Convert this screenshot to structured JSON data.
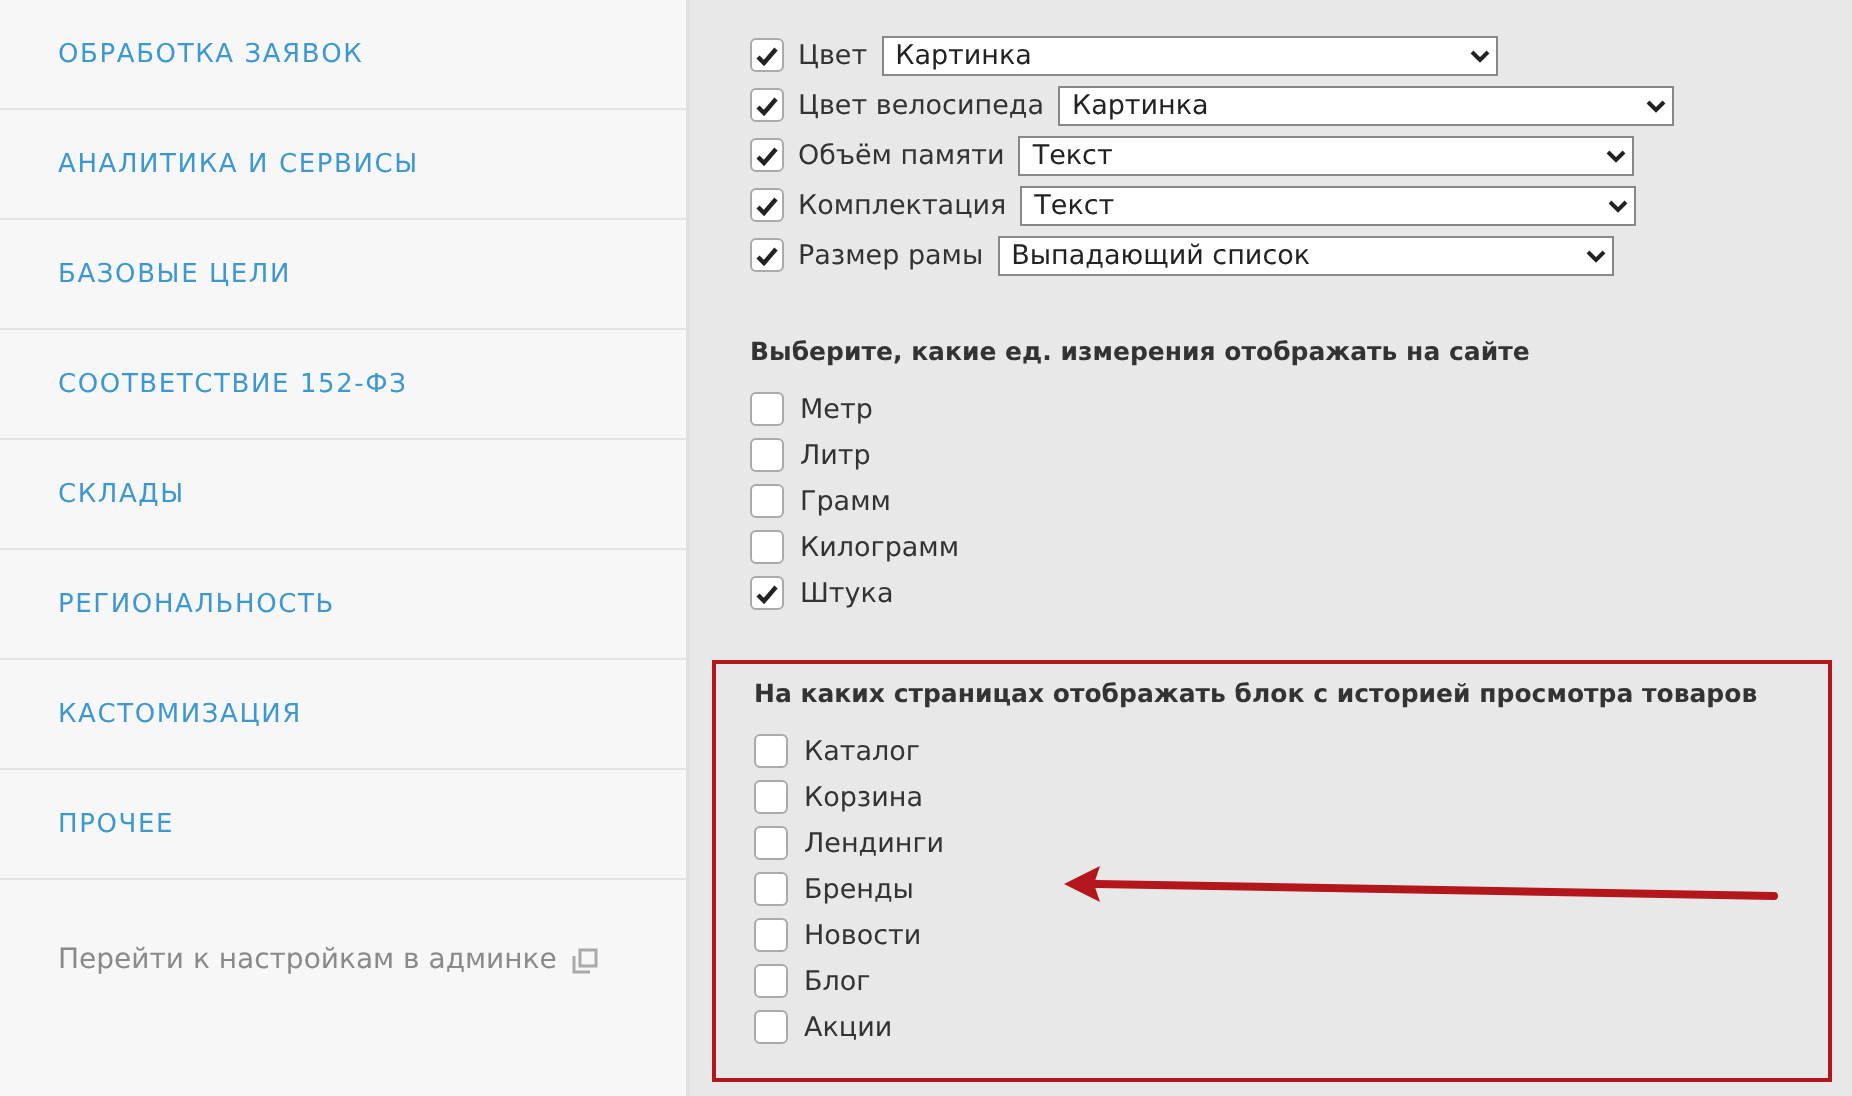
{
  "sidebar": {
    "items": [
      {
        "label": "ОБРАБОТКА ЗАЯВОК"
      },
      {
        "label": "АНАЛИТИКА И СЕРВИСЫ"
      },
      {
        "label": "БАЗОВЫЕ ЦЕЛИ"
      },
      {
        "label": "СООТВЕТСТВИЕ 152-ФЗ"
      },
      {
        "label": "СКЛАДЫ"
      },
      {
        "label": "РЕГИОНАЛЬНОСТЬ"
      },
      {
        "label": "КАСТОМИЗАЦИЯ"
      },
      {
        "label": "ПРОЧЕЕ"
      }
    ],
    "admin_link": "Перейти к настройкам в админке"
  },
  "properties": [
    {
      "label": "Цвет",
      "checked": true,
      "value": "Картинка"
    },
    {
      "label": "Цвет велосипеда",
      "checked": true,
      "value": "Картинка"
    },
    {
      "label": "Объём памяти",
      "checked": true,
      "value": "Текст"
    },
    {
      "label": "Комплектация",
      "checked": true,
      "value": "Текст"
    },
    {
      "label": "Размер рамы",
      "checked": true,
      "value": "Выпадающий список"
    }
  ],
  "units": {
    "heading": "Выберите, какие ед. измерения отображать на сайте",
    "options": [
      {
        "label": "Метр",
        "checked": false
      },
      {
        "label": "Литр",
        "checked": false
      },
      {
        "label": "Грамм",
        "checked": false
      },
      {
        "label": "Килограмм",
        "checked": false
      },
      {
        "label": "Штука",
        "checked": true
      }
    ]
  },
  "history_pages": {
    "heading": "На каких страницах отображать блок с историей просмотра товаров",
    "highlighted": true,
    "options": [
      {
        "label": "Каталог",
        "checked": false
      },
      {
        "label": "Корзина",
        "checked": false
      },
      {
        "label": "Лендинги",
        "checked": false
      },
      {
        "label": "Бренды",
        "checked": false
      },
      {
        "label": "Новости",
        "checked": false
      },
      {
        "label": "Блог",
        "checked": false
      },
      {
        "label": "Акции",
        "checked": false
      }
    ]
  }
}
